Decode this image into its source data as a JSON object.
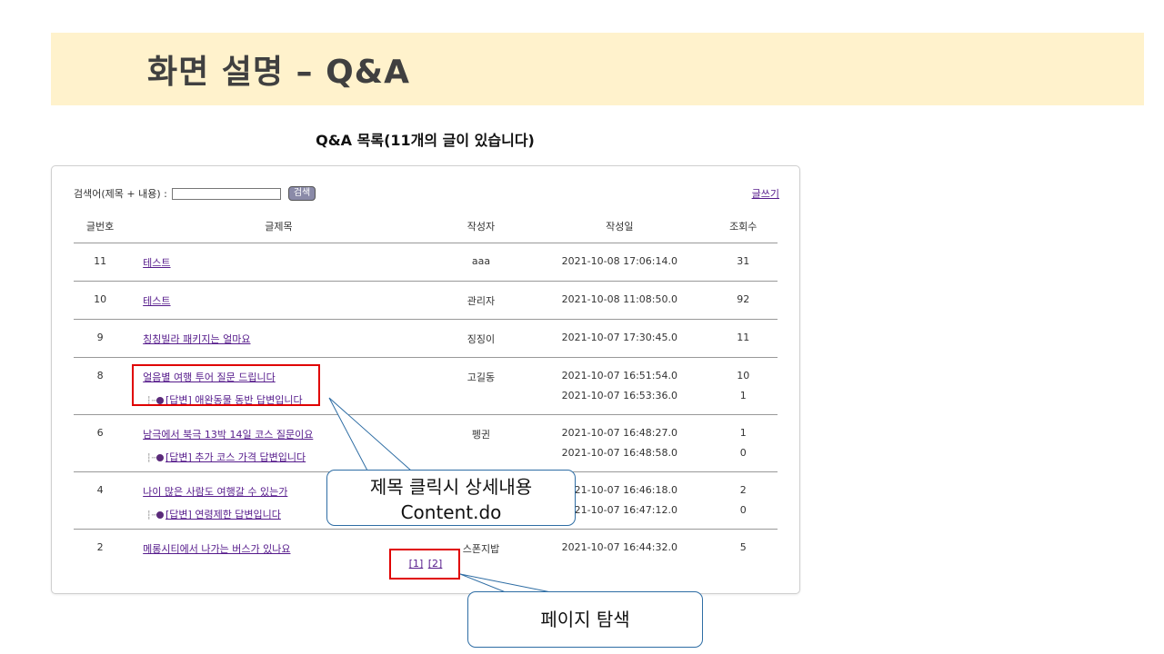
{
  "header": {
    "title": "화면 설명 – Q&A"
  },
  "board": {
    "heading": "Q&A 목록(11개의 글이 있습니다)",
    "search_label": "검색어(제목 + 내용) :",
    "search_value": "",
    "search_button": "검색",
    "write_link": "글쓰기",
    "columns": [
      "글번호",
      "글제목",
      "작성자",
      "작성일",
      "조회수"
    ],
    "rows": [
      {
        "num": "11",
        "title": "테스트",
        "writer": "aaa",
        "date": "2021-10-08 17:06:14.0",
        "views": "31"
      },
      {
        "num": "10",
        "title": "테스트",
        "writer": "관리자",
        "date": "2021-10-08 11:08:50.0",
        "views": "92"
      },
      {
        "num": "9",
        "title": "칭칭빌라 패키지는 얼마요",
        "writer": "징징이",
        "date": "2021-10-07 17:30:45.0",
        "views": "11"
      },
      {
        "num": "8",
        "title": "얼음별 여행 투어 질문 드립니다",
        "writer": "고길동",
        "date": "2021-10-07 16:51:54.0",
        "views": "10",
        "reply": {
          "title": "[답변] 애완동물 동반 답변입니다",
          "date": "2021-10-07 16:53:36.0",
          "views": "1"
        }
      },
      {
        "num": "6",
        "title": "남극에서 북극 13박 14일 코스 질문이요",
        "writer": "펭귄",
        "date": "2021-10-07 16:48:27.0",
        "views": "1",
        "reply": {
          "title": "[답변] 추가 코스 가격 답변입니다",
          "date": "2021-10-07 16:48:58.0",
          "views": "0"
        }
      },
      {
        "num": "4",
        "title": "나이 많은 사람도 여행갈 수 있는가",
        "writer": "",
        "date": "2021-10-07 16:46:18.0",
        "views": "2",
        "reply": {
          "title": "[답변] 연령제한 답변입니다",
          "date": "2021-10-07 16:47:12.0",
          "views": "0"
        }
      },
      {
        "num": "2",
        "title": "메롱시티에서 나가는 버스가 있나요",
        "writer": "스폰지밥",
        "date": "2021-10-07 16:44:32.0",
        "views": "5"
      }
    ],
    "pages": [
      "[1]",
      "[2]"
    ]
  },
  "annotations": {
    "title_click_line1": "제목 클릭시 상세내용",
    "title_click_line2": "Content.do",
    "page_nav": "페이지 탐색",
    "highlight_color": "#e00000",
    "callout_border_color": "#2e6da4"
  }
}
